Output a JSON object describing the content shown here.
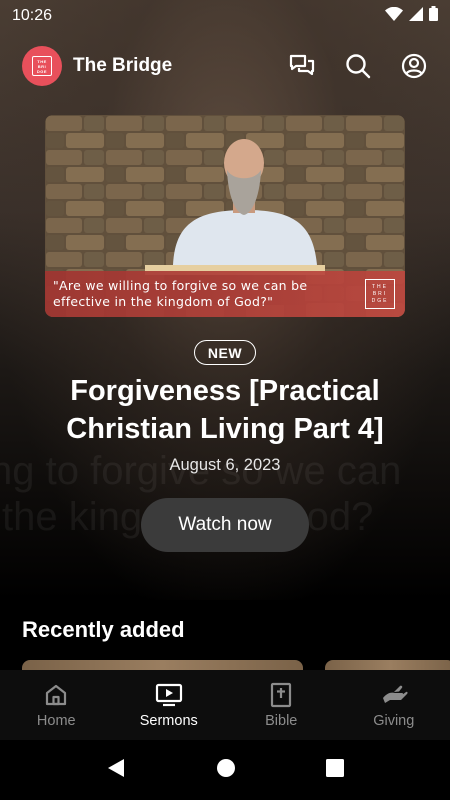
{
  "status_bar": {
    "time": "10:26",
    "icons": [
      "wifi-icon",
      "signal-icon",
      "battery-icon"
    ]
  },
  "header": {
    "app_title": "The Bridge",
    "logo_text": [
      "THE",
      "BRI",
      "DGE"
    ],
    "actions": [
      "chat-icon",
      "search-icon",
      "account-icon"
    ]
  },
  "hero": {
    "caption": "\"Are we willing to forgive so we can be effective in the kingdom of God?\"",
    "caption_logo": [
      "THE",
      "BRI",
      "DGE"
    ],
    "badge": "NEW",
    "title": "Forgiveness [Practical Christian Living Part 4]",
    "date": "August 6, 2023",
    "watch_label": "Watch now",
    "background_text": [
      "ng to forgive so we can",
      "the kingdom of God?"
    ]
  },
  "sections": {
    "recently_added": "Recently added"
  },
  "bottom_nav": {
    "items": [
      {
        "label": "Home",
        "icon": "home-icon",
        "active": false
      },
      {
        "label": "Sermons",
        "icon": "sermons-icon",
        "active": true
      },
      {
        "label": "Bible",
        "icon": "bible-icon",
        "active": false
      },
      {
        "label": "Giving",
        "icon": "giving-icon",
        "active": false
      }
    ]
  },
  "system_nav": [
    "back-icon",
    "home-circle-icon",
    "recents-icon"
  ],
  "colors": {
    "brand": "#e8505b",
    "caption_bar": "#a83430",
    "button_bg": "#3b3b3b",
    "nav_inactive": "#8c8c8c"
  }
}
